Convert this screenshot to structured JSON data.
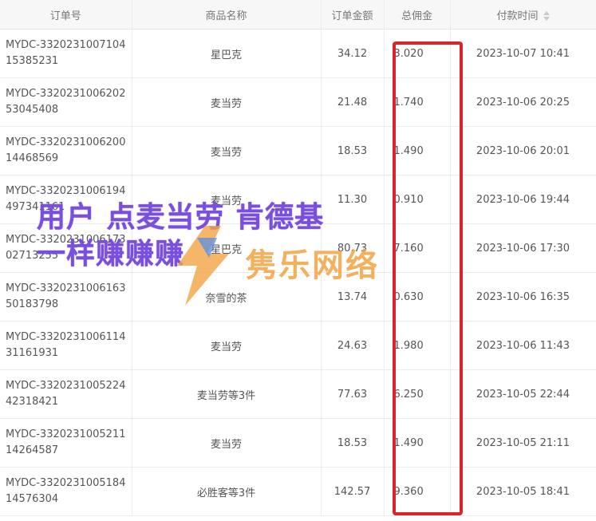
{
  "table": {
    "headers": {
      "order_id": "订单号",
      "product": "商品名称",
      "amount": "订单金额",
      "commission": "总佣金",
      "paid_time": "付款时间"
    },
    "rows": [
      {
        "order_id": "MYDC-332023100710415385231",
        "product": "星巴克",
        "amount": "34.12",
        "commission": "3.020",
        "paid_time": "2023-10-07 10:41"
      },
      {
        "order_id": "MYDC-332023100620253045408",
        "product": "麦当劳",
        "amount": "21.48",
        "commission": "1.740",
        "paid_time": "2023-10-06 20:25"
      },
      {
        "order_id": "MYDC-332023100620014468569",
        "product": "麦当劳",
        "amount": "18.53",
        "commission": "1.490",
        "paid_time": "2023-10-06 20:01"
      },
      {
        "order_id": "MYDC-3320231006194497341161",
        "product": "麦当劳",
        "amount": "11.30",
        "commission": "0.910",
        "paid_time": "2023-10-06 19:44"
      },
      {
        "order_id": "MYDC-332023100617302713255",
        "product": "星巴克",
        "amount": "80.73",
        "commission": "7.160",
        "paid_time": "2023-10-06 17:30"
      },
      {
        "order_id": "MYDC-332023100616350183798",
        "product": "奈雪的茶",
        "amount": "13.74",
        "commission": "0.630",
        "paid_time": "2023-10-06 16:35"
      },
      {
        "order_id": "MYDC-332023100611431161931",
        "product": "麦当劳",
        "amount": "24.63",
        "commission": "1.980",
        "paid_time": "2023-10-06 11:43"
      },
      {
        "order_id": "MYDC-332023100522442318421",
        "product": "麦当劳等3件",
        "amount": "77.63",
        "commission": "6.250",
        "paid_time": "2023-10-05 22:44"
      },
      {
        "order_id": "MYDC-332023100521114264587",
        "product": "麦当劳",
        "amount": "18.53",
        "commission": "1.490",
        "paid_time": "2023-10-05 21:11"
      },
      {
        "order_id": "MYDC-332023100518414576304",
        "product": "必胜客等3件",
        "amount": "142.57",
        "commission": "9.360",
        "paid_time": "2023-10-05 18:41"
      }
    ]
  },
  "overlay": {
    "line1": "用户 点麦当劳 肯德基",
    "line2": "一样赚赚赚",
    "logo_text": "隽乐网络"
  },
  "colors": {
    "highlight": "#d9262e",
    "overlay_text": "#7a4fe0",
    "logo": "#f2a443"
  }
}
